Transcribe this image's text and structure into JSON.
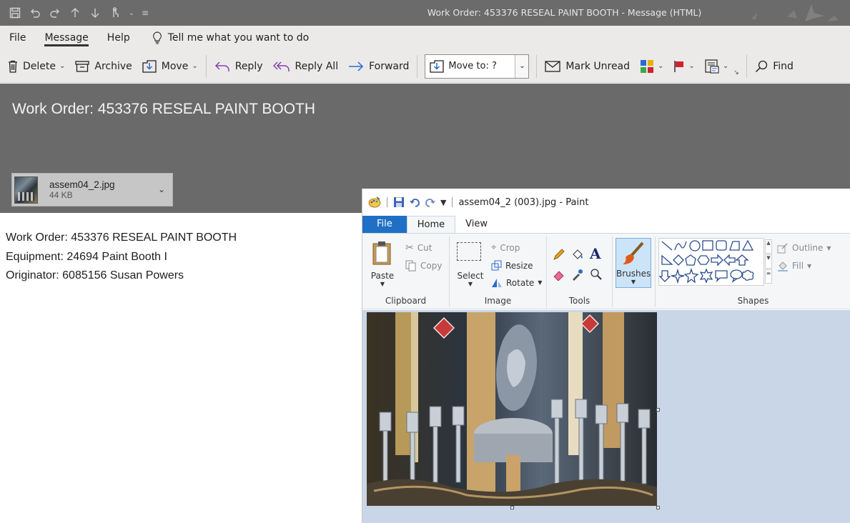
{
  "outlook": {
    "window_title": "Work Order: 453376 RESEAL PAINT BOOTH  -  Message (HTML)",
    "menu": {
      "file": "File",
      "message": "Message",
      "help": "Help",
      "tell_me": "Tell me what you want to do"
    },
    "ribbon": {
      "delete": "Delete",
      "archive": "Archive",
      "move": "Move",
      "reply": "Reply",
      "reply_all": "Reply All",
      "forward": "Forward",
      "move_to": "Move to: ?",
      "mark_unread": "Mark Unread",
      "find": "Find"
    },
    "message": {
      "subject": "Work Order: 453376 RESEAL PAINT BOOTH",
      "attachment": {
        "name": "assem04_2.jpg",
        "size": "44 KB"
      },
      "body_lines": [
        "Work Order: 453376 RESEAL PAINT BOOTH",
        "Equipment: 24694 Paint Booth I",
        "Originator: 6085156 Susan Powers"
      ]
    },
    "colors": {
      "title_bar": "#6b6b6b",
      "ribbon": "#ebeae9",
      "header": "#6a6a6a",
      "flag": "#d1202f",
      "reply_all_purple": "#8a3fb0",
      "forward_blue": "#2a6ad0"
    }
  },
  "paint": {
    "title": "assem04_2 (003).jpg - Paint",
    "tabs": {
      "file": "File",
      "home": "Home",
      "view": "View"
    },
    "clipboard": {
      "paste": "Paste",
      "cut": "Cut",
      "copy": "Copy",
      "label": "Clipboard"
    },
    "image": {
      "select": "Select",
      "crop": "Crop",
      "resize": "Resize",
      "rotate": "Rotate",
      "label": "Image"
    },
    "tools": {
      "label": "Tools",
      "text_tool": "A"
    },
    "brushes": "Brushes",
    "shapes": {
      "label": "Shapes",
      "outline": "Outline",
      "fill": "Fill"
    },
    "colors": {
      "file_tab": "#1f6fc5",
      "canvas_bg": "#c9d6e8"
    }
  }
}
